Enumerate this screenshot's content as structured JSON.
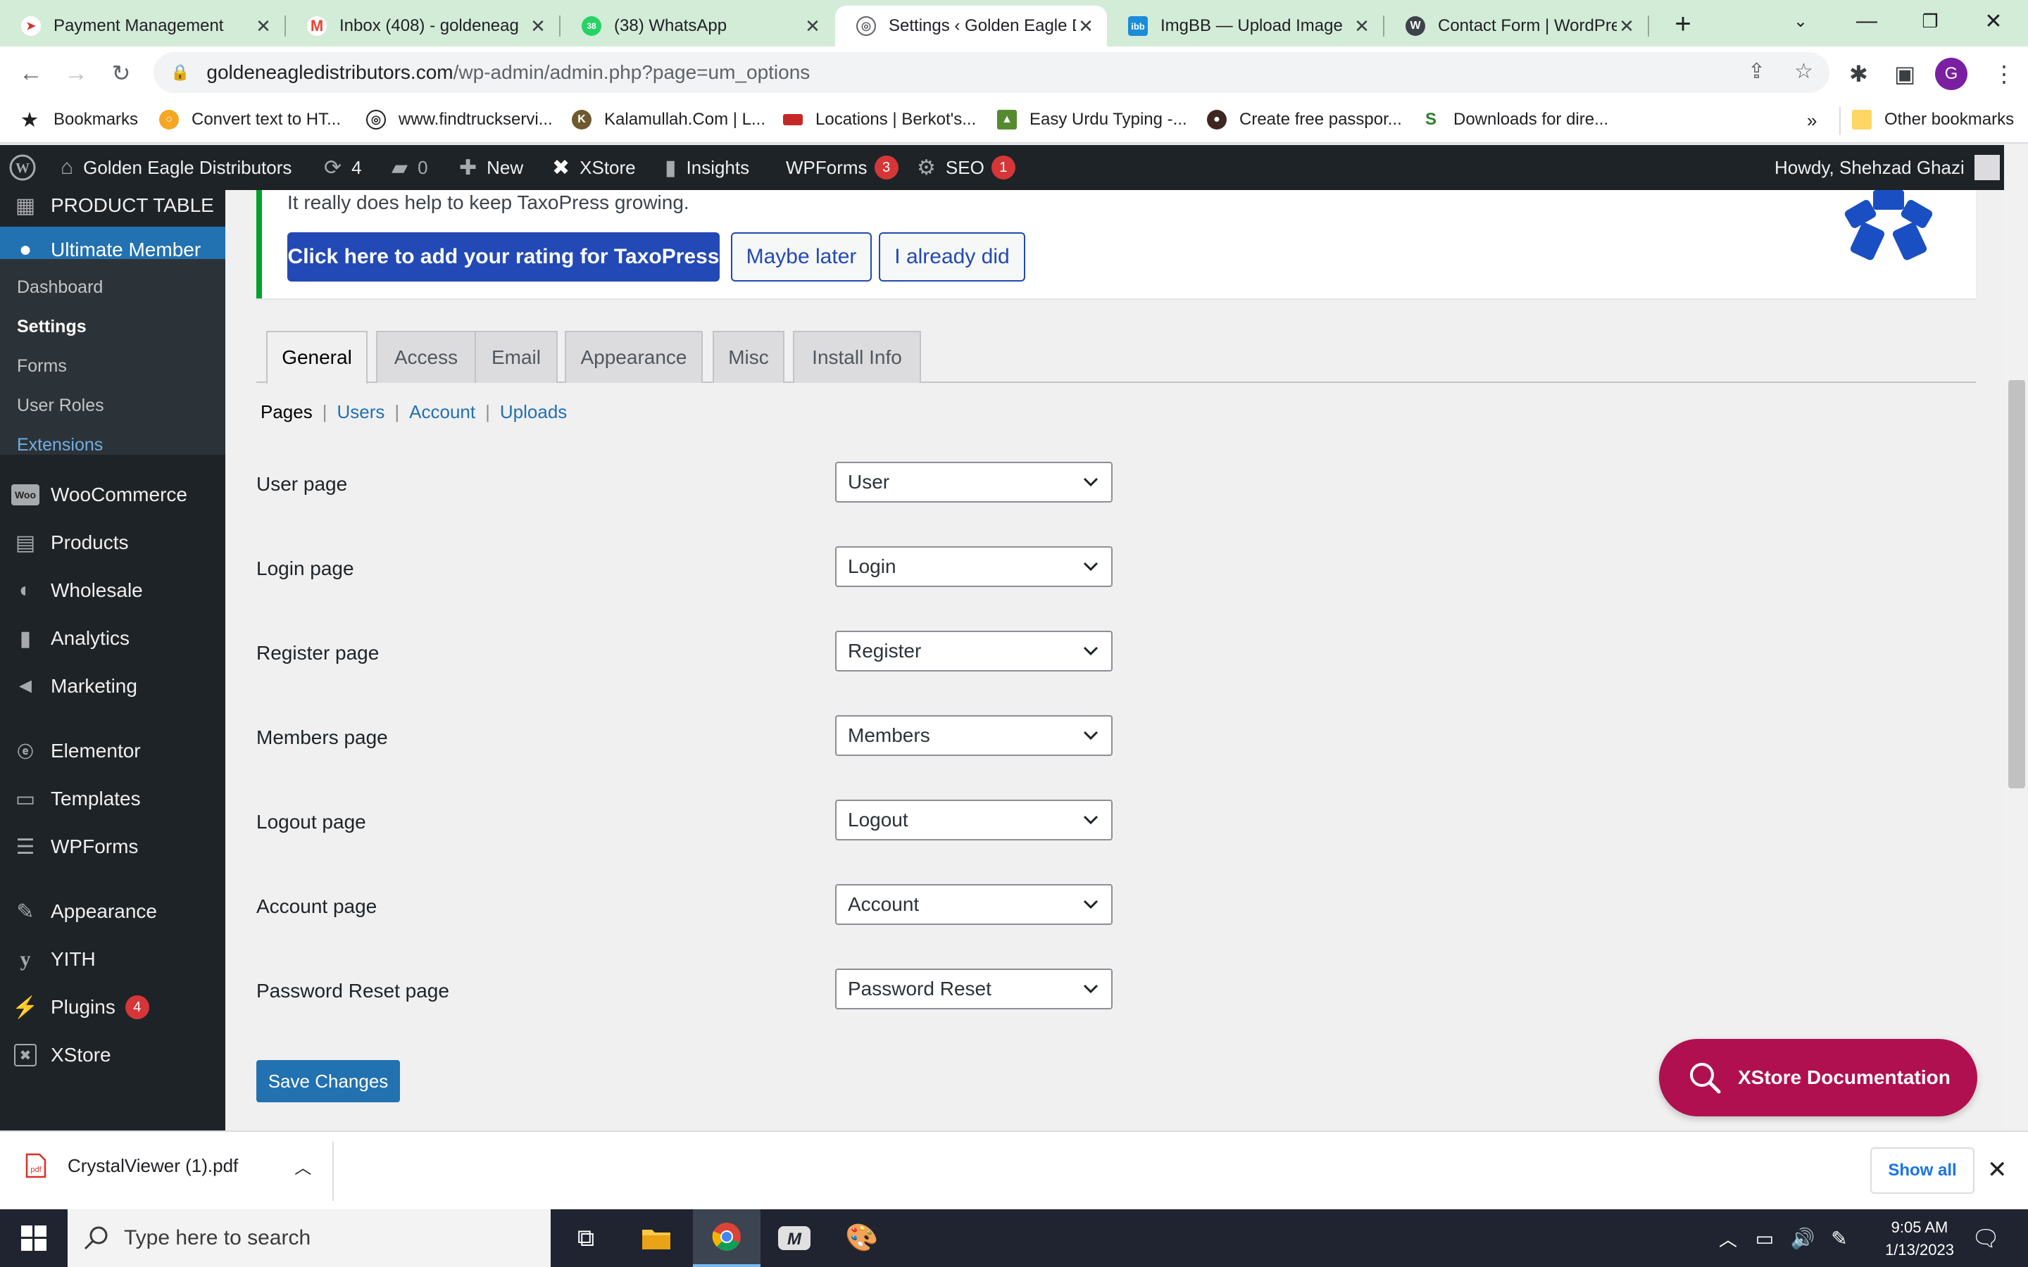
{
  "browser": {
    "tabs": [
      {
        "title": "Payment Management"
      },
      {
        "title": "Inbox (408) - goldeneag"
      },
      {
        "title": "(38) WhatsApp"
      },
      {
        "title": "Settings ‹ Golden Eagle D"
      },
      {
        "title": "ImgBB — Upload Image"
      },
      {
        "title": "Contact Form | WordPre"
      }
    ],
    "new_tab": "+",
    "url_host": "goldeneagledistributors.com",
    "url_path": "/wp-admin/admin.php?page=um_options",
    "profile_initial": "G"
  },
  "bookmarks": {
    "items": [
      {
        "label": "Bookmarks"
      },
      {
        "label": "Convert text to HT..."
      },
      {
        "label": "www.findtruckservi..."
      },
      {
        "label": "Kalamullah.Com | L..."
      },
      {
        "label": "Locations | Berkot's..."
      },
      {
        "label": "Easy Urdu Typing -..."
      },
      {
        "label": "Create free passpor..."
      },
      {
        "label": "Downloads for dire..."
      }
    ],
    "overflow": "»",
    "other": "Other bookmarks"
  },
  "adminbar": {
    "site_name": "Golden Eagle Distributors",
    "updates": "4",
    "comments": "0",
    "new": "New",
    "xstore": "XStore",
    "insights": "Insights",
    "wpforms": "WPForms",
    "wpforms_count": "3",
    "seo": "SEO",
    "seo_count": "1",
    "howdy": "Howdy, Shehzad Ghazi"
  },
  "sidebar": {
    "product_table": "PRODUCT TABLE",
    "ultimate_member": "Ultimate Member",
    "submenu": [
      "Dashboard",
      "Settings",
      "Forms",
      "User Roles",
      "Extensions"
    ],
    "items": [
      {
        "label": "WooCommerce"
      },
      {
        "label": "Products"
      },
      {
        "label": "Wholesale"
      },
      {
        "label": "Analytics"
      },
      {
        "label": "Marketing"
      },
      {
        "label": "Elementor"
      },
      {
        "label": "Templates"
      },
      {
        "label": "WPForms"
      },
      {
        "label": "Appearance"
      },
      {
        "label": "YITH"
      },
      {
        "label": "Plugins"
      },
      {
        "label": "XStore"
      }
    ],
    "plugins_count": "4"
  },
  "notice": {
    "text": "It really does help to keep TaxoPress growing.",
    "rate_button": "Click here to add your rating for TaxoPress",
    "later_button": "Maybe later",
    "did_button": "I already did"
  },
  "tabs": [
    "General",
    "Access",
    "Email",
    "Appearance",
    "Misc",
    "Install Info"
  ],
  "subnav": {
    "current": "Pages",
    "links": [
      "Users",
      "Account",
      "Uploads"
    ],
    "separator": "|"
  },
  "fields": [
    {
      "label": "User page",
      "value": "User"
    },
    {
      "label": "Login page",
      "value": "Login"
    },
    {
      "label": "Register page",
      "value": "Register"
    },
    {
      "label": "Members page",
      "value": "Members"
    },
    {
      "label": "Logout page",
      "value": "Logout"
    },
    {
      "label": "Account page",
      "value": "Account"
    },
    {
      "label": "Password Reset page",
      "value": "Password Reset"
    }
  ],
  "save_button": "Save Changes",
  "xstore_doc": "XStore Documentation",
  "downloads": {
    "file": "CrystalViewer (1).pdf",
    "show_all": "Show all"
  },
  "taskbar": {
    "search_placeholder": "Type here to search",
    "time": "9:05 AM",
    "date": "1/13/2023"
  },
  "colors": {
    "wp_blue": "#2271b1",
    "admin_dark": "#1d2327",
    "notice_green": "#00a32a",
    "xstore_magenta": "#b0104f",
    "taxopress_blue": "#2249b5"
  }
}
